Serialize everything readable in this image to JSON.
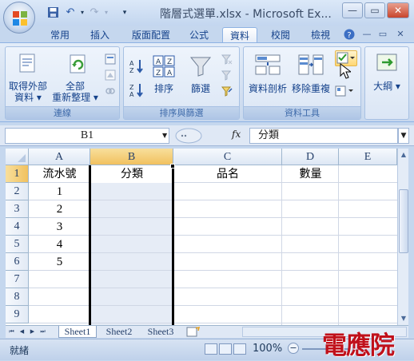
{
  "window": {
    "title": "階層式選單.xlsx - Microsoft Ex...",
    "minimize": "—",
    "restore": "▭",
    "close": "✕"
  },
  "quick_access": {
    "save_icon": "save-icon",
    "undo_icon": "undo-icon",
    "redo_icon": "redo-icon",
    "more": "▾"
  },
  "tabs": [
    "常用",
    "插入",
    "版面配置",
    "公式",
    "資料",
    "校閱",
    "檢視"
  ],
  "active_tab": "資料",
  "ribbon": {
    "connections": {
      "label": "連線",
      "get_external_line1": "取得外部",
      "get_external_line2": "資料 ▾",
      "refresh_line1": "全部",
      "refresh_line2": "重新整理 ▾"
    },
    "sort_filter": {
      "label": "排序與篩選",
      "sort": "排序",
      "filter": "篩選",
      "az": "A↓Z",
      "za": "Z↓A"
    },
    "data_tools": {
      "label": "資料工具",
      "text_to_columns": "資料剖析",
      "remove_duplicates": "移除重複"
    },
    "outline": {
      "label": "大綱 ▾"
    }
  },
  "formula_bar": {
    "name_box": "B1",
    "fx": "fx",
    "content": "分類"
  },
  "columns": [
    "A",
    "B",
    "C",
    "D",
    "E"
  ],
  "rows": [
    "1",
    "2",
    "3",
    "4",
    "5",
    "6",
    "7",
    "8",
    "9"
  ],
  "selected_column": "B",
  "selected_row": "1",
  "cells": {
    "A1": "流水號",
    "B1": "分類",
    "C1": "品名",
    "D1": "數量",
    "A2": "1",
    "A3": "2",
    "A4": "3",
    "A5": "4",
    "A6": "5"
  },
  "sheets": [
    "Sheet1",
    "Sheet2",
    "Sheet3"
  ],
  "active_sheet": "Sheet1",
  "status": {
    "ready": "就緒",
    "zoom": "100%"
  },
  "watermark": "電應院",
  "colors": {
    "accent": "#15428b",
    "selected_header": "#f1c15f",
    "watermark": "#c0101a"
  }
}
